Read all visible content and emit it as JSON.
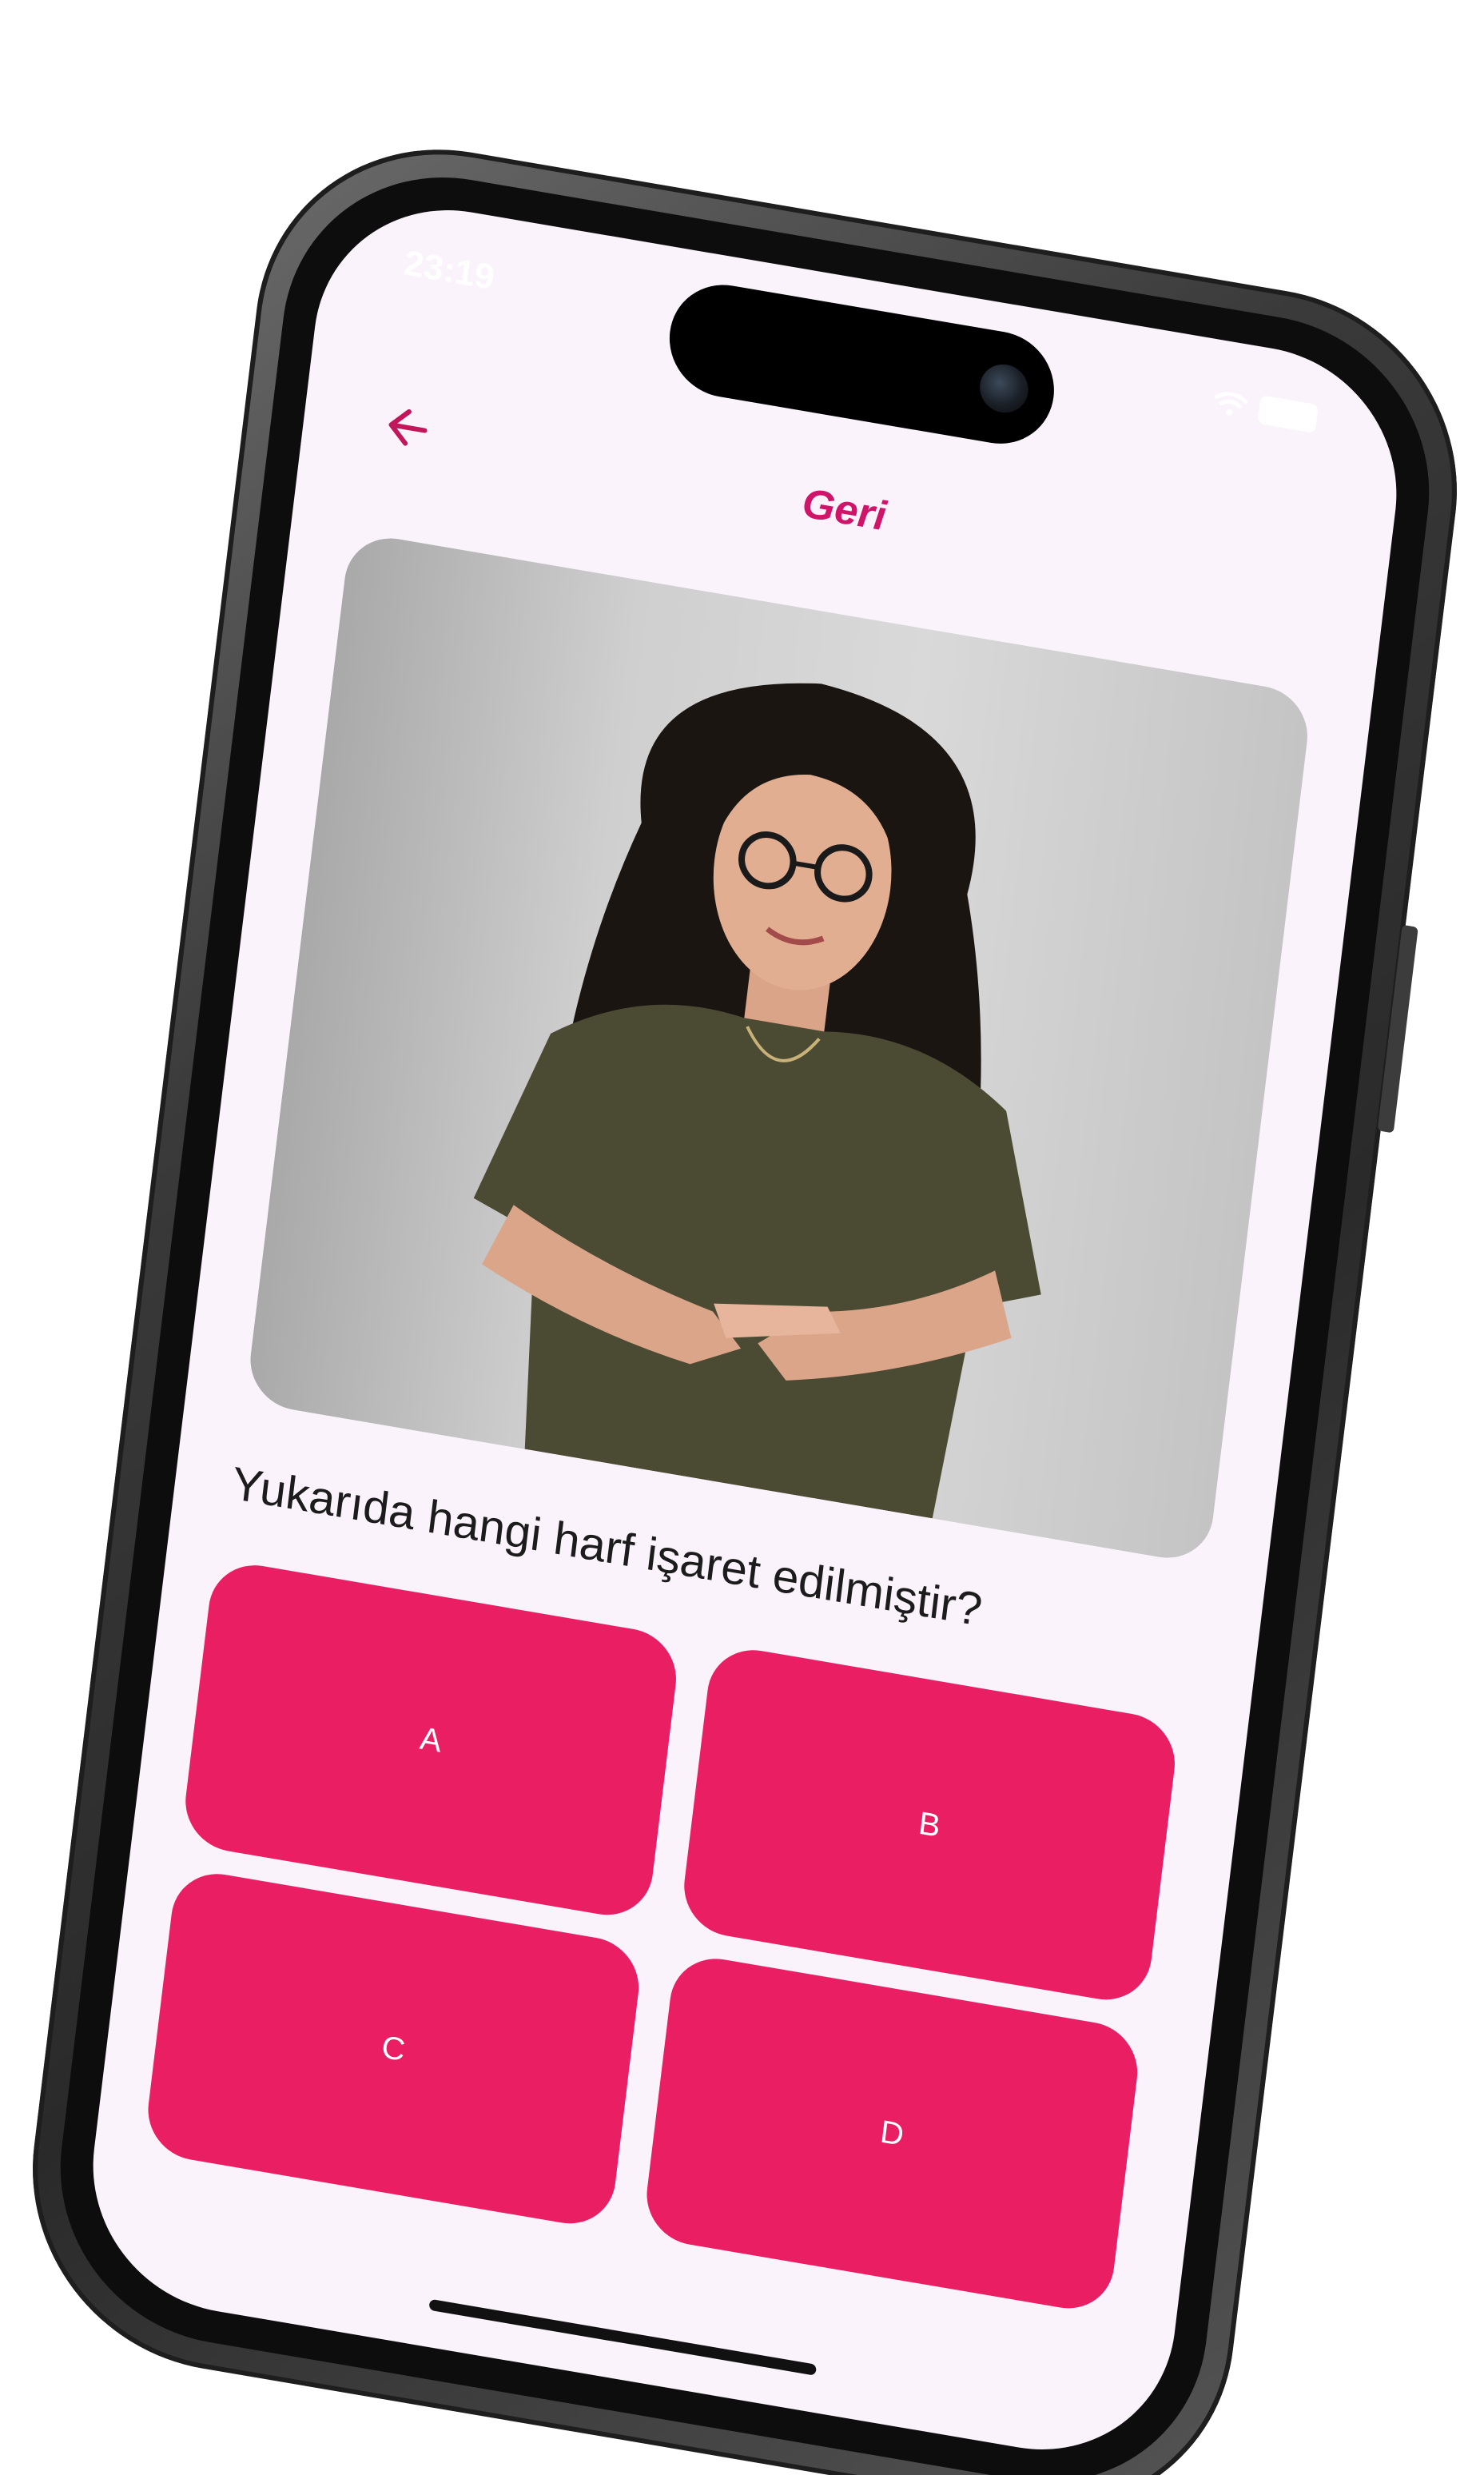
{
  "status_bar": {
    "time": "23:19"
  },
  "appbar": {
    "back_icon": "arrow-left-icon",
    "title": "Geri"
  },
  "quiz": {
    "image_alt": "sign-language-letter-photo",
    "question": "Yukarıda hangi harf işaret edilmiştir?",
    "options": [
      "A",
      "B",
      "C",
      "D"
    ]
  },
  "colors": {
    "accent": "#d0146a",
    "button": "#e91e63",
    "screen_bg": "#fbf3fb"
  }
}
